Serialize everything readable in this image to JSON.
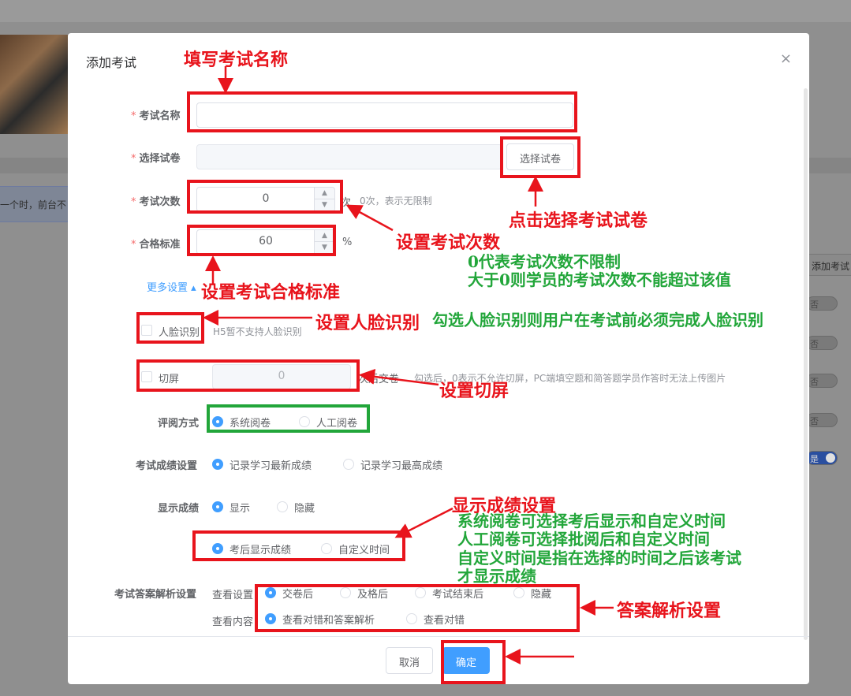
{
  "background": {
    "notice_text": "一个时，前台不",
    "right_button": "添加考试",
    "toggle_off": "否",
    "toggle_on": "是"
  },
  "dialog": {
    "title": "添加考试",
    "close_glyph": "×",
    "required_mark": "*",
    "exam_name": {
      "label": "考试名称",
      "value": ""
    },
    "paper": {
      "label": "选择试卷",
      "button": "选择试卷"
    },
    "attempts": {
      "label": "考试次数",
      "value": "0",
      "unit": "次",
      "hint": "0次，表示无限制"
    },
    "passing": {
      "label": "合格标准",
      "value": "60",
      "unit": "%"
    },
    "more_settings": "更多设置",
    "face": {
      "label": "人脸识别",
      "hint": "H5暂不支持人脸识别"
    },
    "switch_screen": {
      "label": "切屏",
      "value": "0",
      "unit": "次后交卷",
      "hint": "勾选后，0表示不允许切屏，PC端填空题和简答题学员作答时无法上传图片"
    },
    "grading": {
      "label": "评阅方式",
      "options": [
        "系统阅卷",
        "人工阅卷"
      ],
      "selected": "系统阅卷"
    },
    "score_setting": {
      "label": "考试成绩设置",
      "options": [
        "记录学习最新成绩",
        "记录学习最高成绩"
      ],
      "selected": "记录学习最新成绩"
    },
    "show_score": {
      "label": "显示成绩",
      "options": [
        "显示",
        "隐藏"
      ],
      "selected": "显示"
    },
    "show_timing": {
      "options": [
        "考后显示成绩",
        "自定义时间"
      ],
      "selected": "考后显示成绩"
    },
    "analysis": {
      "label": "考试答案解析设置",
      "view_setting_label": "查看设置",
      "view_setting_options": [
        "交卷后",
        "及格后",
        "考试结束后",
        "隐藏"
      ],
      "view_setting_selected": "交卷后",
      "view_content_label": "查看内容",
      "view_content_options": [
        "查看对错和答案解析",
        "查看对错"
      ],
      "view_content_selected": "查看对错和答案解析"
    },
    "footer": {
      "cancel": "取消",
      "confirm": "确定"
    }
  },
  "annotations": {
    "fill_name": "填写考试名称",
    "click_paper": "点击选择考试试卷",
    "set_attempts": "设置考试次数",
    "attempts_note_1": "0代表考试次数不限制",
    "attempts_note_2": "大于0则学员的考试次数不能超过该值",
    "set_passing": "设置考试合格标准",
    "set_face": "设置人脸识别",
    "face_note": "勾选人脸识别则用户在考试前必须完成人脸识别",
    "set_switch": "设置切屏",
    "score_display": "显示成绩设置",
    "score_note_1": "系统阅卷可选择考后显示和自定义时间",
    "score_note_2": "人工阅卷可选择批阅后和自定义时间",
    "score_note_3": "自定义时间是指在选择的时间之后该考试",
    "score_note_4": "才显示成绩",
    "analysis_setting": "答案解析设置",
    "annotation_red": "#e8141c",
    "annotation_green": "#22a63a"
  },
  "colors": {
    "primary": "#409eff",
    "required": "#f56c6c"
  }
}
